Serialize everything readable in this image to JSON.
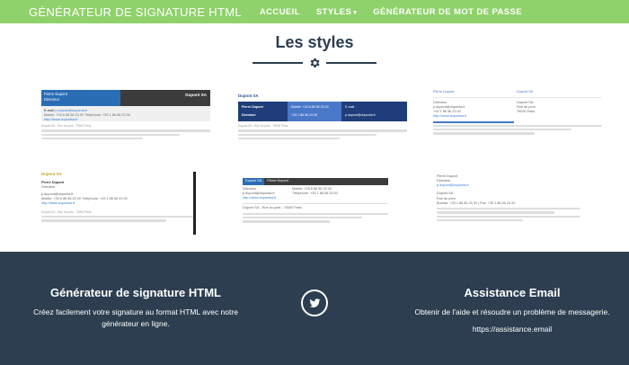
{
  "nav": {
    "brand": "GÉNÉRATEUR DE SIGNATURE HTML",
    "links": [
      "ACCUEIL",
      "STYLES",
      "GÉNÉRATEUR DE MOT DE PASSE"
    ]
  },
  "section": {
    "title": "Les styles"
  },
  "styles": {
    "name": "Pierre Dupont",
    "title": "Directeur",
    "company": "Dupont SA",
    "email_label": "E-mail",
    "email": "p.dupont@duponta.fr",
    "mobile": "Mobile: +33 6 86 56 23 00",
    "phone": "Téléphone: +33 1 86 56 23 00",
    "phone_short": "+33 1 86 56 23 00",
    "website": "http://www.dupontsa.fr",
    "address": "Dupont SA - Rue du pont - 75000 Paris",
    "street": "Rue du pont",
    "city": "75000 Paris",
    "bureau": "Bureau: +33 1 86 56 23 00 | Fax: +33 1 86 56 23 00"
  },
  "footer": {
    "left": {
      "title": "Générateur de signature HTML",
      "text": "Créez facilement votre signature au format HTML avec notre générateur en ligne."
    },
    "social_icon": "twitter-icon",
    "right": {
      "title": "Assistance Email",
      "text": "Obtenir de l'aide et résoudre un problème de messagerie.",
      "url": "https://assistance.email"
    }
  },
  "colors": {
    "nav": "#8fd16a",
    "footer": "#2c3e50",
    "accent_blue": "#2a6db5"
  }
}
